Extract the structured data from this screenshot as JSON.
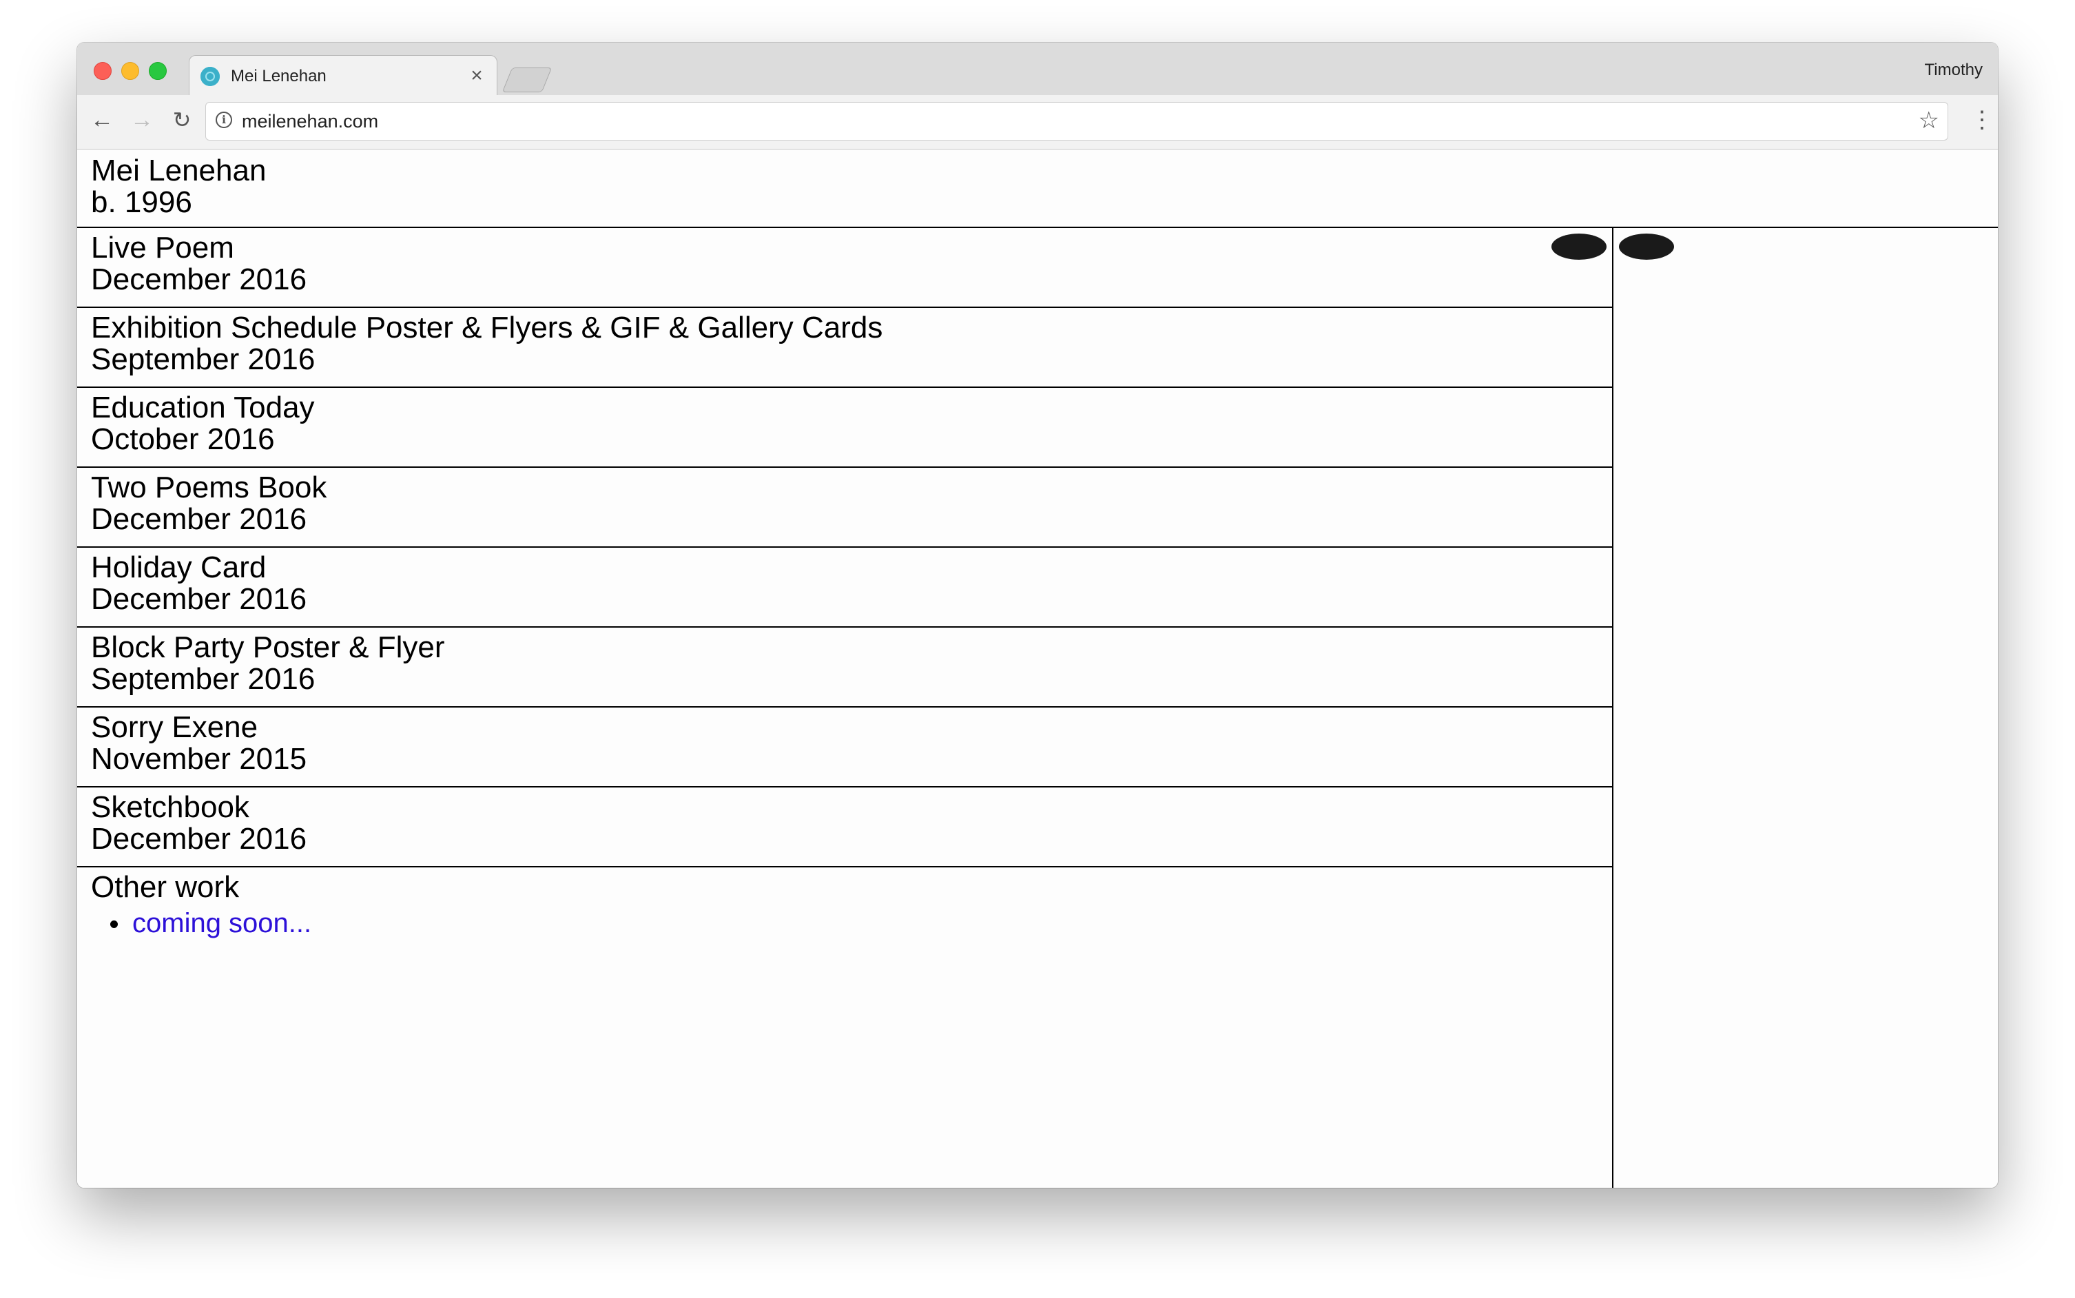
{
  "browser": {
    "tab_title": "Mei Lenehan",
    "tab_close": "×",
    "profile_name": "Timothy",
    "url": "meilenehan.com",
    "icons": {
      "back": "arrow-left-icon",
      "forward": "arrow-right-icon",
      "reload": "reload-icon",
      "info": "info-icon",
      "bookmark": "star-icon",
      "menu": "kebab-menu-icon"
    }
  },
  "header": {
    "name": "Mei Lenehan",
    "born": "b. 1996"
  },
  "projects": [
    {
      "title": "Live Poem",
      "date": "December 2016"
    },
    {
      "title": "Exhibition Schedule Poster & Flyers & GIF & Gallery Cards",
      "date": "September 2016"
    },
    {
      "title": "Education Today",
      "date": "October 2016"
    },
    {
      "title": "Two Poems Book",
      "date": "December 2016"
    },
    {
      "title": "Holiday Card",
      "date": "December 2016"
    },
    {
      "title": "Block Party Poster & Flyer",
      "date": "September 2016"
    },
    {
      "title": "Sorry Exene",
      "date": "November 2015"
    },
    {
      "title": "Sketchbook",
      "date": "December 2016"
    }
  ],
  "other_work": {
    "heading": "Other work",
    "items": [
      "coming soon..."
    ]
  },
  "colors": {
    "link": "#2c10d8",
    "rule": "#000000",
    "page_bg": "#fdfdfd"
  }
}
